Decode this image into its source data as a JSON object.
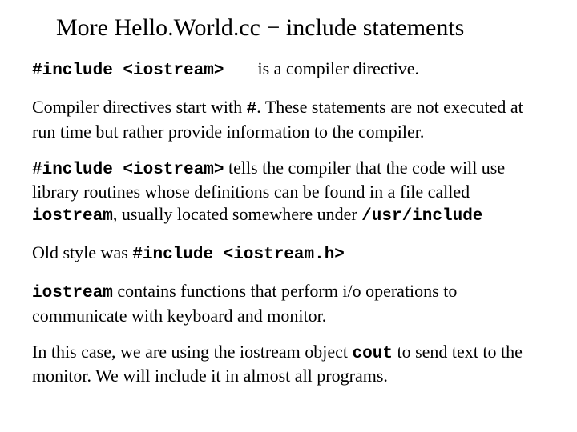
{
  "title": "More Hello.World.cc − include statements",
  "p1": {
    "code": "#include <iostream>",
    "tail": "is a compiler directive."
  },
  "p2": {
    "a": "Compiler directives start with ",
    "hash": "#",
    "b": ".   These statements are not executed at run time but rather provide information to the compiler."
  },
  "p3": {
    "code": "#include <iostream>",
    "a": " tells the compiler that the code will use library routines whose definitions can be found in a file called ",
    "ios": "iostream",
    "b": ", usually located somewhere under ",
    "path": "/usr/include"
  },
  "p4": {
    "a": "Old style was  ",
    "code": "#include <iostream.h>"
  },
  "p5": {
    "ios": "iostream",
    "a": "  contains functions that perform i/o operations to communicate with keyboard and monitor."
  },
  "p6": {
    "a": "In this case, we are using the iostream object ",
    "cout": "cout",
    "b": " to send text to the monitor.  We will include it in almost all programs."
  }
}
